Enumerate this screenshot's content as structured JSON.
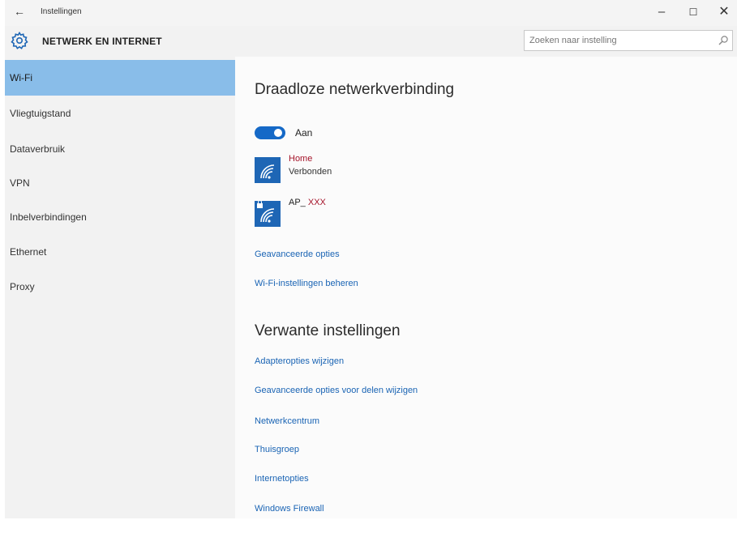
{
  "window": {
    "back_glyph": "←",
    "title": "Instellingen",
    "minimize_glyph": "–",
    "maximize_glyph": "☐",
    "close_glyph": "✕"
  },
  "header": {
    "title": "NETWERK EN INTERNET",
    "search_placeholder": "Zoeken naar instelling"
  },
  "sidebar": {
    "items": [
      {
        "label": "Wi-Fi",
        "selected": true
      },
      {
        "label": "Vliegtuigstand"
      },
      {
        "label": "Dataverbruik"
      },
      {
        "label": "VPN"
      },
      {
        "label": "Inbelverbindingen"
      },
      {
        "label": "Ethernet"
      },
      {
        "label": "Proxy"
      }
    ]
  },
  "main": {
    "title": "Draadloze netwerkverbinding",
    "toggle_label": "Aan",
    "networks": [
      {
        "name": "Home",
        "status": "Verbonden"
      },
      {
        "name_prefix": "AP_",
        "name_suffix": "XXX"
      }
    ],
    "links": [
      "Geavanceerde opties",
      "Wi-Fi-instellingen beheren"
    ],
    "related_title": "Verwante instellingen",
    "related_links": [
      "Adapteropties wijzigen",
      "Geavanceerde opties voor delen wijzigen",
      "Netwerkcentrum",
      "Thuisgroep",
      "Internetopties",
      "Windows Firewall"
    ]
  },
  "colors": {
    "accent": "#1569c7",
    "selected_bg": "#89bde9",
    "link": "#1a64b4",
    "network_name": "#a5142a"
  },
  "icons": {
    "back": "back-arrow-icon",
    "settings": "gear-icon",
    "search": "search-icon",
    "wifi": "wifi-icon"
  }
}
